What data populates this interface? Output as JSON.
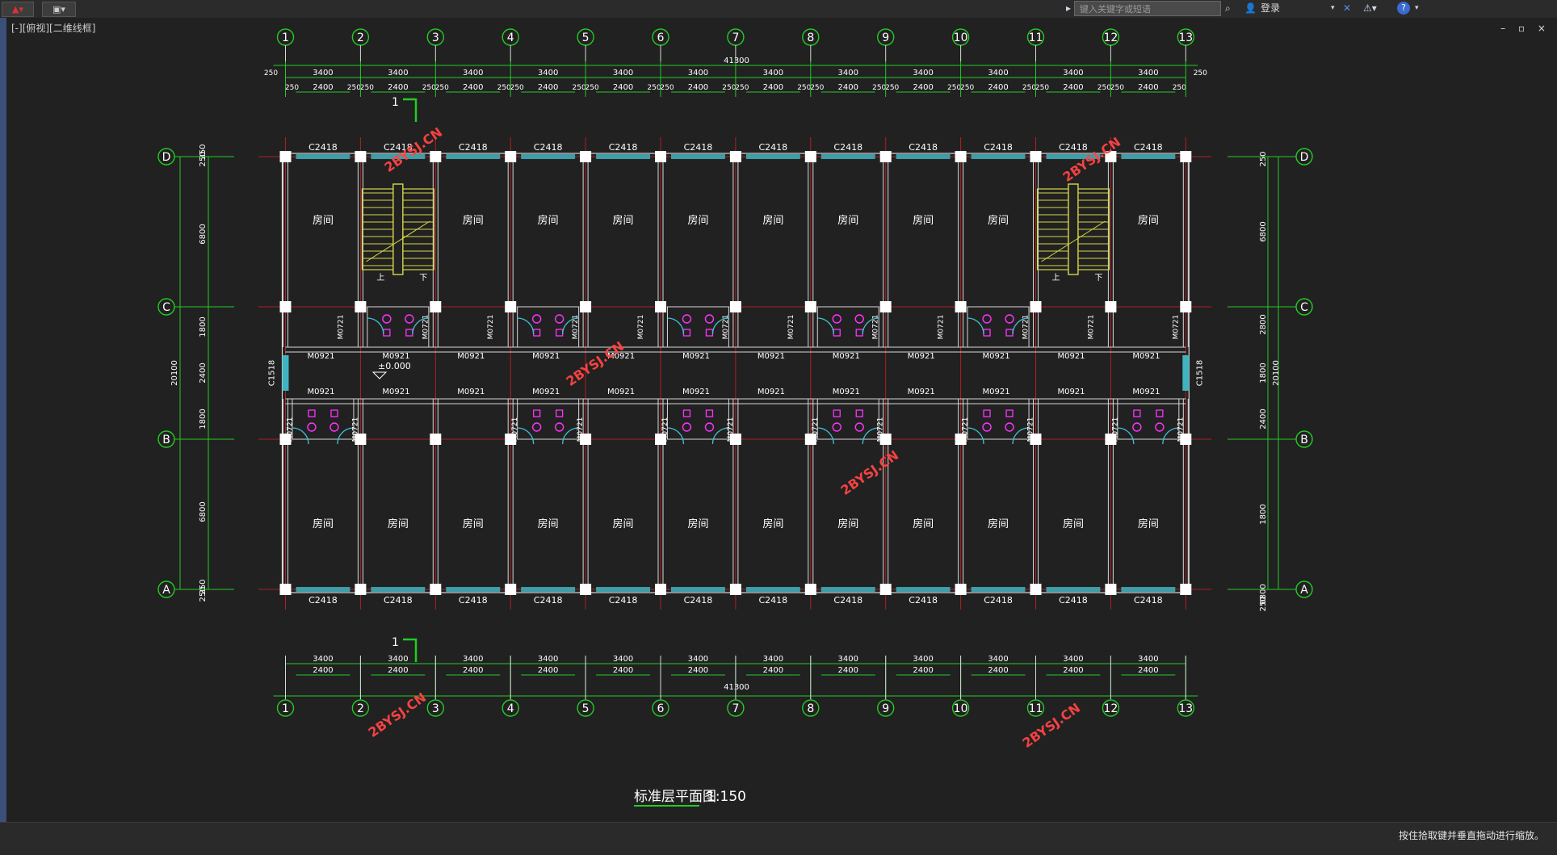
{
  "app": {
    "search_placeholder": "键入关键字或短语",
    "login_label": "登录",
    "viewport_label": "[-][俯视][二维线框]",
    "window_controls": "– ▫ ×",
    "status_text": "按住拾取键并垂直拖动进行缩放。"
  },
  "drawing": {
    "title": "标准层平面图",
    "scale": "1:150",
    "axes_cols": [
      "1",
      "2",
      "3",
      "4",
      "5",
      "6",
      "7",
      "8",
      "9",
      "10",
      "11",
      "12",
      "13"
    ],
    "axes_rows": [
      "D",
      "C",
      "B",
      "A"
    ],
    "total_length": "41300",
    "total_width": "20100",
    "bay_dims": [
      "3400",
      "3400",
      "3400",
      "3400",
      "3400",
      "3400",
      "3400",
      "3400",
      "3400",
      "3400",
      "3400",
      "3400"
    ],
    "wall_offset": "250",
    "window_dim": "2400",
    "row_dims_left": [
      "250",
      "250",
      "6800",
      "1800",
      "2400",
      "1800",
      "6800",
      "250",
      "250"
    ],
    "row_dims_right": [
      "250",
      "6800",
      "2800",
      "1800",
      "2400",
      "1800",
      "6800",
      "250"
    ],
    "window_tag": "C2418",
    "side_window_tag": "C1518",
    "door_tag": "M0921",
    "wc_door_tag": "M0721",
    "room_label": "房间",
    "level_mark": "±0.000",
    "stair_up": "上",
    "stair_down": "下",
    "section_mark": "1",
    "watermark": "2BYSJ.CN"
  }
}
